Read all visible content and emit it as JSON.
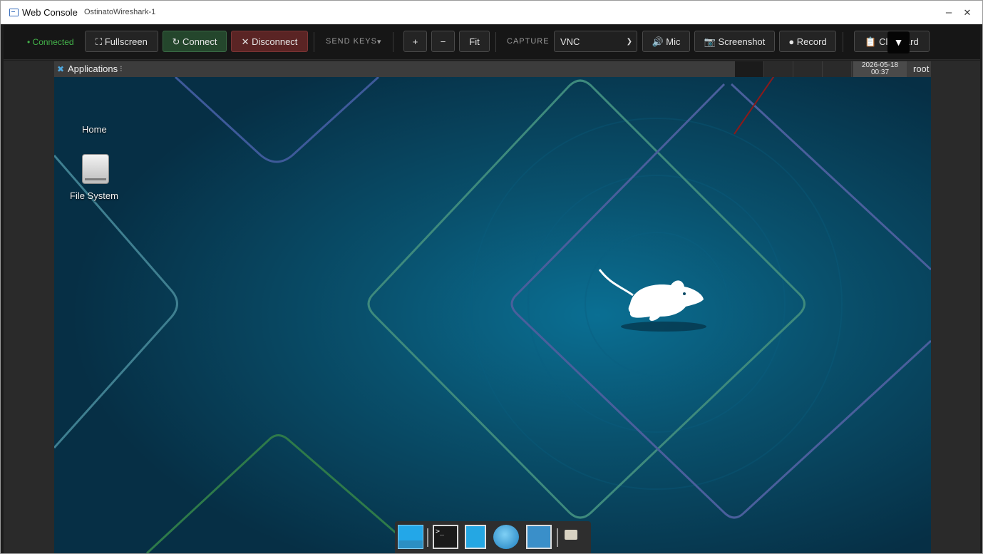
{
  "window": {
    "title": "Web Console",
    "subtitle": "OstinatoWireshark-1",
    "minimize_glyph": "–",
    "close_glyph": "✕"
  },
  "toolbar": {
    "status": "• Connected",
    "fullscreen": "⛶ Fullscreen",
    "connect": "↻ Connect",
    "disconnect": "✕ Disconnect",
    "send_keys": "SEND KEYS",
    "send_keys_arrow": "▾",
    "zoom_in": "+",
    "zoom_out": "−",
    "fit": "Fit",
    "capture_label": "CAPTURE",
    "capture_selected": "VNC",
    "mic": "🔊 Mic",
    "screenshot": "📷 Screenshot",
    "record": "● Record",
    "clipboard": "📋 Clipboard",
    "overlay_arrow": "▼"
  },
  "desktop": {
    "applications": "Applications",
    "applications_suffix": "⁝",
    "clock_date": "2026-05-18",
    "clock_time": "00:37",
    "user": "root",
    "icons": [
      {
        "label": "Home"
      },
      {
        "label": "File System"
      }
    ]
  },
  "dock": {
    "items": [
      "show-desktop",
      "terminal",
      "file-manager",
      "web-browser",
      "app-finder",
      "folder"
    ]
  },
  "colors": {
    "accent_green": "#43b34a",
    "wallpaper_blue": "#073a52",
    "annotation_arrow": "#8b1a1a"
  }
}
